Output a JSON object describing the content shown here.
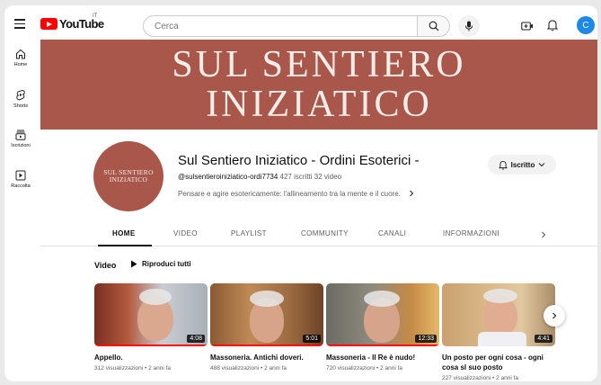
{
  "topbar": {
    "logo_text": "YouTube",
    "logo_region": "IT",
    "search_placeholder": "Cerca",
    "avatar_letter": "C"
  },
  "sidebar": {
    "items": [
      {
        "label": "Home",
        "icon": "home-icon"
      },
      {
        "label": "Shorts",
        "icon": "shorts-icon"
      },
      {
        "label": "Iscrizioni",
        "icon": "subscriptions-icon"
      },
      {
        "label": "Raccolta",
        "icon": "library-icon"
      }
    ]
  },
  "banner": {
    "line1": "SUL SENTIERO",
    "line2": "INIZIATICO",
    "color": "#a9564b"
  },
  "channel": {
    "avatar_line1": "SUL SENTIERO",
    "avatar_line2": "INIZIATICO",
    "name": "Sul Sentiero Iniziatico - Ordini Esoterici -",
    "handle": "@sulsentieroiniziatico-ordi7734",
    "subscribers": "427 iscritti",
    "videos": "32 video",
    "description": "Pensare e agire esotericamente: l'allineamento tra la mente e il cuore.",
    "subscribed_label": "Iscritto"
  },
  "tabs": [
    {
      "label": "HOME",
      "active": true
    },
    {
      "label": "VIDEO"
    },
    {
      "label": "PLAYLIST"
    },
    {
      "label": "COMMUNITY"
    },
    {
      "label": "CANALI"
    },
    {
      "label": "INFORMAZIONI"
    }
  ],
  "video_section": {
    "title": "Video",
    "play_all": "Riproduci tutti"
  },
  "videos": [
    {
      "title": "Appello.",
      "title2": "",
      "views": "312 visualizzazioni",
      "age": "2 anni fa",
      "duration": "4:08",
      "watched": 1.0
    },
    {
      "title": "Massoneria. Antichi doveri.",
      "title2": "",
      "views": "488 visualizzazioni",
      "age": "2 anni fa",
      "duration": "5:01",
      "watched": 1.0
    },
    {
      "title": "Massoneria - Il Re è nudo!",
      "title2": "",
      "views": "720 visualizzazioni",
      "age": "2 anni fa",
      "duration": "12:33",
      "watched": 1.0
    },
    {
      "title": "Un posto per ogni cosa - ogni",
      "title2": "cosa sl suo posto",
      "views": "227 visualizzazioni",
      "age": "2 anni fa",
      "duration": "4:41",
      "watched": 0
    }
  ]
}
